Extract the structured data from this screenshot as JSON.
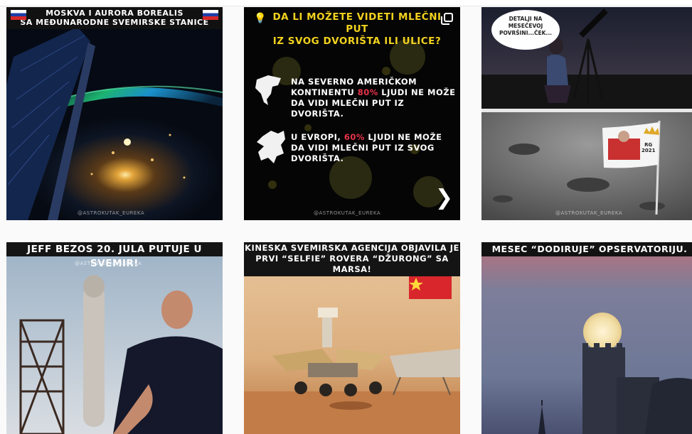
{
  "posts": [
    {
      "caption": [
        "MOSKVA I AURORA BOREALIS",
        "SA MEĐUNARODNE SVEMIRSKE STANICE"
      ],
      "watermark": "@ASTROKUTAK_EUREKA"
    },
    {
      "title": [
        "DA LI MOŽETE VIDETI MLEČNI PUT",
        "IZ SVOG DVORIŠTA ILI ULICE?"
      ],
      "fact1": {
        "before": [
          "NA SEVERNO AMERIČKOM",
          "KONTINENTU "
        ],
        "highlight": "80%",
        "after": [
          " LJUDI NE MOŽE",
          "DA VIDI MLEČNI PUT IZ DVORIŠTA."
        ]
      },
      "fact2": {
        "before": [
          "U EVROPI, "
        ],
        "highlight": "60%",
        "after": [
          " LJUDI NE MOŽE",
          "DA VIDI MLEČNI PUT IZ SVOG",
          "DVORIŠTA."
        ]
      },
      "watermark": "@ASTROKUTAK_EUREKA",
      "next_glyph": "❯",
      "carousel_icon": "multi-image-icon"
    },
    {
      "bubble": [
        "DETALJI NA",
        "MESEČEVOJ",
        "POVRŠINI...ČEK..."
      ],
      "flag_label": [
        "RG",
        "2021"
      ],
      "watermark": "@ASTROKUTAK_EUREKA"
    },
    {
      "caption": "JEFF BEZOS 20. JULA PUTUJE U SVEMIR!",
      "watermark": "@ASTROKUTAK_EUREKA"
    },
    {
      "caption": [
        "KINESKA SVEMIRSKA AGENCIJA OBJAVILA JE",
        "PRVI “SELFIE” ROVERA “DŽURONG” SA MARSA!"
      ]
    },
    {
      "caption": "MESEC “DODIRUJE” OPSERVATORIJU."
    }
  ],
  "colors": {
    "highlight": "#e8334a",
    "title_yellow": "#f2d21e",
    "background": "#fafafa"
  }
}
